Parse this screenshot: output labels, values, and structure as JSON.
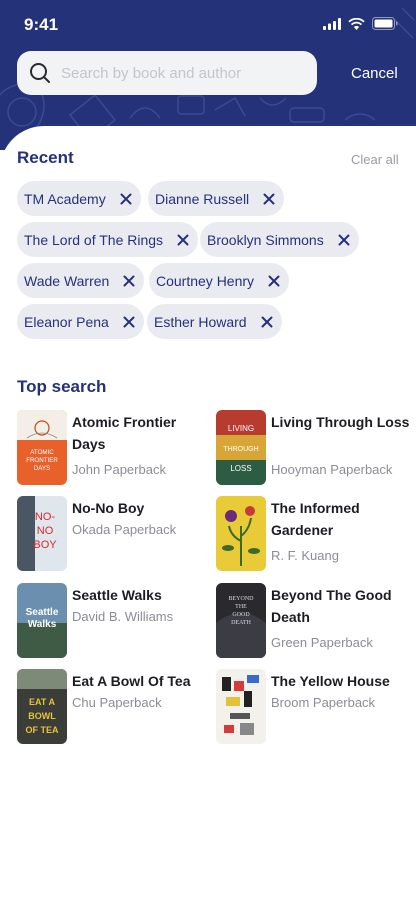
{
  "status": {
    "time": "9:41"
  },
  "search": {
    "placeholder": "Search by book and author",
    "cancel_label": "Cancel"
  },
  "recent": {
    "title": "Recent",
    "clear_label": "Clear all",
    "chips": [
      "TM Academy",
      "Dianne Russell",
      "The Lord of The Rings",
      "Brooklyn Simmons",
      "Wade Warren",
      "Courtney Henry",
      "Eleanor Pena",
      "Esther Howard"
    ]
  },
  "top_search": {
    "title": "Top search",
    "books": [
      {
        "title": "Atomic Frontier Days",
        "author": "John Paperback",
        "cover_text": "ATOMIC FRONTIER DAYS"
      },
      {
        "title": "Living Through Loss",
        "author": "Hooyman Paperback",
        "cover_text": "LIVING THROUGH LOSS"
      },
      {
        "title": "No-No Boy",
        "author": "Okada Paperback",
        "cover_text": "NO-NO BOY"
      },
      {
        "title": "The Informed Gardener",
        "author": "R. F. Kuang",
        "cover_text": ""
      },
      {
        "title": "Seattle Walks",
        "author": "David B. Williams",
        "cover_text": "Seattle Walks"
      },
      {
        "title": "Beyond The Good Death",
        "author": "Green Paperback",
        "cover_text": "BEYOND THE GOOD DEATH"
      },
      {
        "title": "Eat A Bowl Of Tea",
        "author": "Chu Paperback",
        "cover_text": "EAT A BOWL OF TEA"
      },
      {
        "title": "The Yellow House",
        "author": "Broom Paperback",
        "cover_text": ""
      }
    ]
  },
  "colors": {
    "primary": "#24327a",
    "chip_bg": "#eaebf1",
    "muted": "#8b8d94"
  }
}
